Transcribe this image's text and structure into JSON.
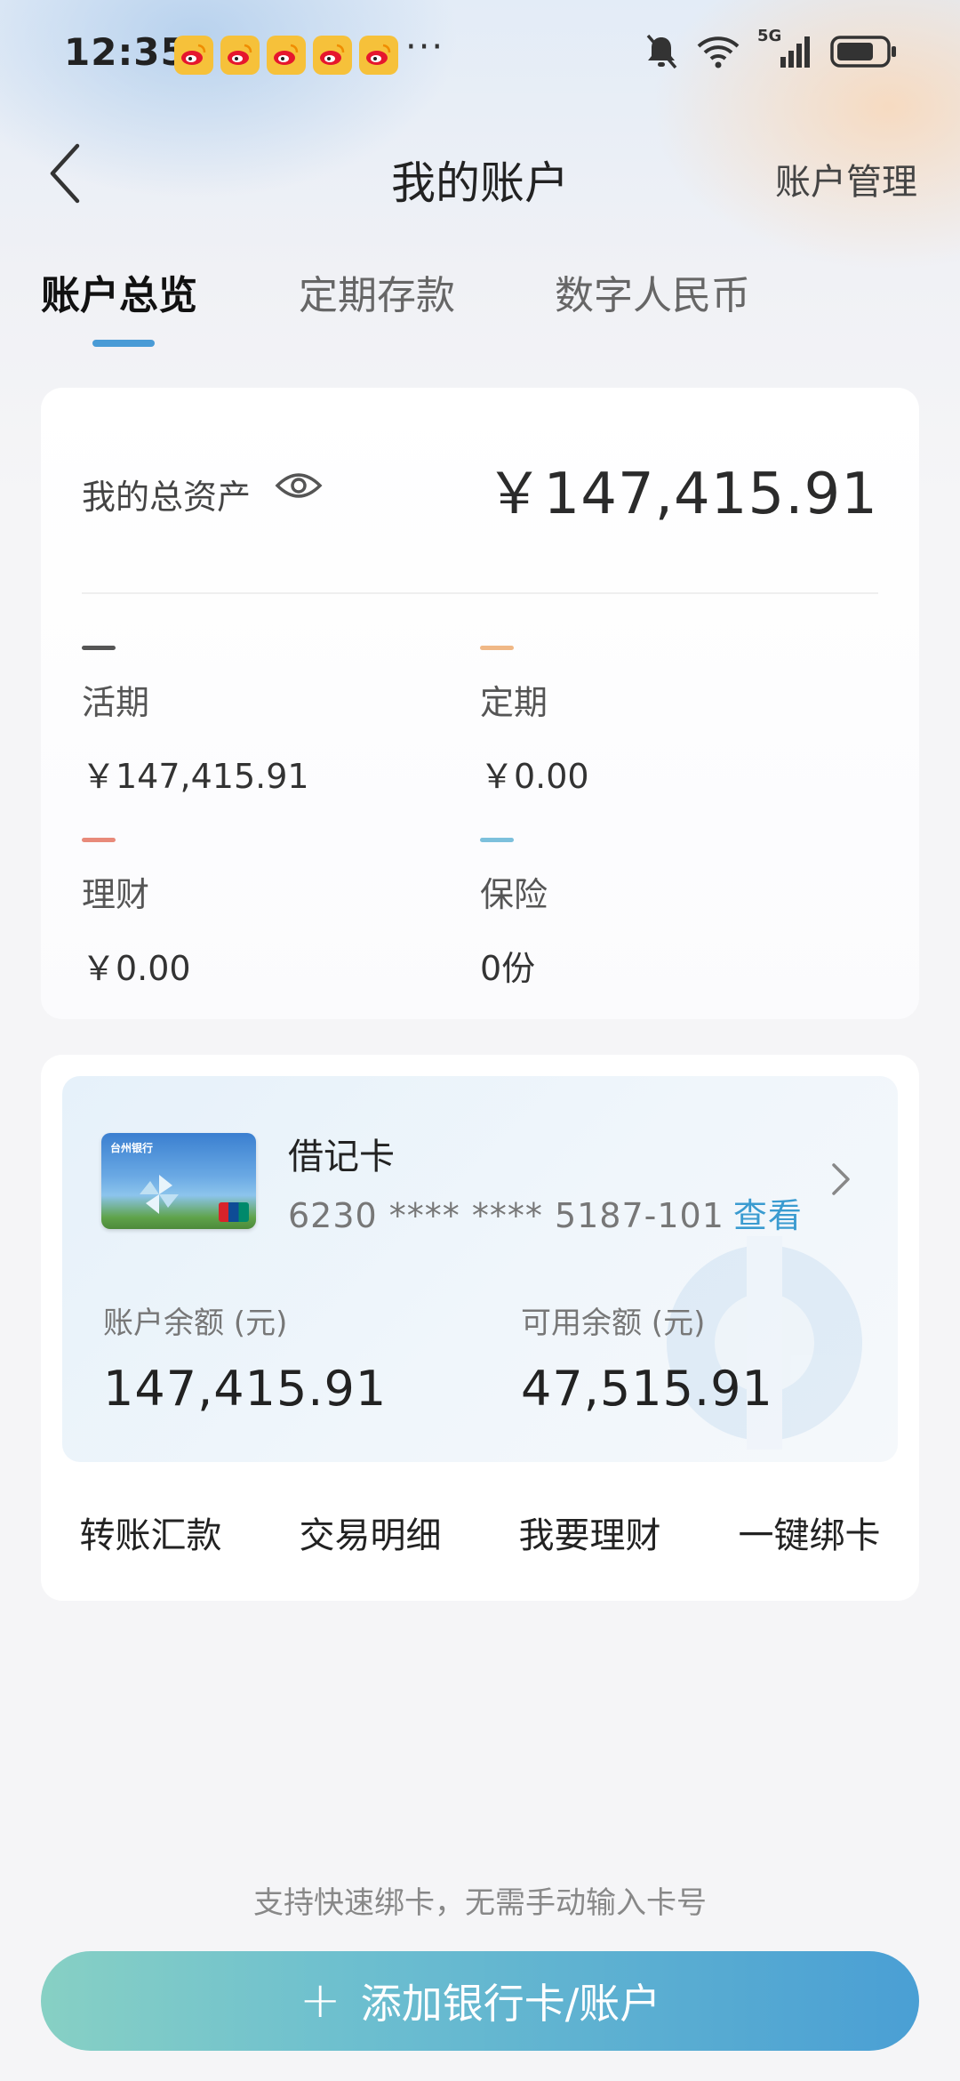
{
  "status_bar": {
    "time": "12:35",
    "more": "···",
    "network": "5G",
    "notif_icons": [
      "weibo-icon",
      "weibo-icon",
      "weibo-icon",
      "weibo-icon",
      "weibo-icon"
    ]
  },
  "header": {
    "title": "我的账户",
    "manage_label": "账户管理"
  },
  "tabs": [
    {
      "label": "账户总览",
      "active": true
    },
    {
      "label": "定期存款",
      "active": false
    },
    {
      "label": "数字人民币",
      "active": false
    }
  ],
  "overview": {
    "total_label": "我的总资产",
    "total_value": "￥147,415.91",
    "items": [
      {
        "label": "活期",
        "value": "￥147,415.91",
        "color": "#555555"
      },
      {
        "label": "定期",
        "value": "￥0.00",
        "color": "#f0b886"
      },
      {
        "label": "理财",
        "value": "￥0.00",
        "color": "#e88a7a"
      },
      {
        "label": "保险",
        "value": "0份",
        "color": "#7cc0dc"
      }
    ]
  },
  "account": {
    "bank_name": "台州银行",
    "card_type": "借记卡",
    "card_number": "6230 **** **** 5187-101",
    "view_label": "查看",
    "balance_label": "账户余额 (元)",
    "balance_value": "147,415.91",
    "available_label": "可用余额 (元)",
    "available_value": "47,515.91",
    "actions": [
      "转账汇款",
      "交易明细",
      "我要理财",
      "一键绑卡"
    ]
  },
  "footer": {
    "hint": "支持快速绑卡，无需手动输入卡号",
    "add_button_label": "添加银行卡/账户",
    "add_icon": "plus-icon",
    "button_gradient": [
      "#87d0c4",
      "#4a9fd4"
    ]
  }
}
